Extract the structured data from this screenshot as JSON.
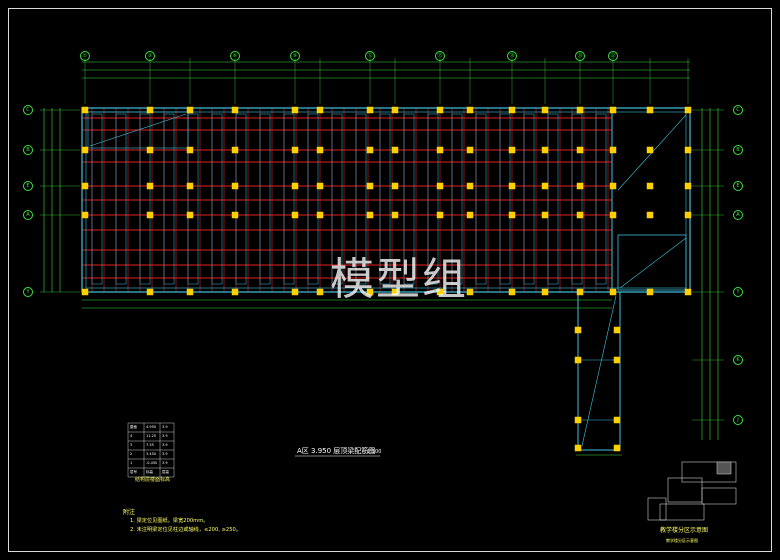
{
  "drawing": {
    "plan_title": "A区 3.950 层顶梁配筋图",
    "plan_scale": "1:100",
    "watermark": "模型组",
    "key_plan_title": "教学楼分区示意图",
    "key_plan_sub": "教学楼分区示意图",
    "legend_title": "结构层楼面标高",
    "notes_heading": "附注",
    "notes": [
      "1. 梁定位见图纸。梁宽200mm。",
      "2. 未注明梁定位见柱边或轴线，≤200, ≥250。"
    ]
  },
  "axes": {
    "top": [
      "①",
      "③",
      "⑥",
      "⑨",
      "⑫",
      "⑮",
      "⑱",
      "⑳",
      "㉒"
    ],
    "left": [
      "C",
      "B",
      "E",
      "A",
      "Y"
    ],
    "right": [
      "C",
      "B",
      "E",
      "A",
      "Y",
      "K",
      "J"
    ]
  },
  "key_plan": {
    "labels": [
      "1",
      "2",
      "3",
      "4",
      "5"
    ]
  },
  "legend": {
    "rows": [
      [
        "屋面",
        "4.950",
        "3.9"
      ],
      [
        "4",
        "11.25",
        "3.9"
      ],
      [
        "3",
        "7.35",
        "3.9"
      ],
      [
        "2",
        "3.450",
        "3.9"
      ],
      [
        "1",
        "-0.450",
        "3.9"
      ],
      [
        "层号",
        "标高",
        "层高"
      ]
    ]
  },
  "colors": {
    "background": "#000000",
    "dimension": "#3fe040",
    "beam_red": "#e02020",
    "wall_cyan": "#40c0e0",
    "column_yellow": "#ffd000",
    "text_yellow": "#ffff66"
  }
}
